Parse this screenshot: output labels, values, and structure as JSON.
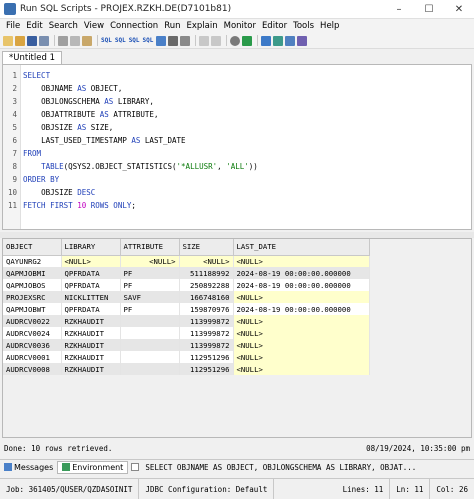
{
  "window": {
    "title": "Run SQL Scripts - PROJEX.RZKH.DE(D7101b81)",
    "minimize": "–",
    "maximize": "☐",
    "close": "✕"
  },
  "menu": [
    "File",
    "Edit",
    "Search",
    "View",
    "Connection",
    "Run",
    "Explain",
    "Monitor",
    "Editor",
    "Tools",
    "Help"
  ],
  "editor_tab": "*Untitled 1",
  "code": {
    "line_numbers": [
      "1",
      "2",
      "3",
      "4",
      "5",
      "6",
      "7",
      "8",
      "9",
      "10",
      "11"
    ]
  },
  "results": {
    "columns": [
      "OBJECT",
      "LIBRARY",
      "ATTRIBUTE",
      "SIZE",
      "LAST_DATE"
    ],
    "rows": [
      [
        "QAYUNRG2",
        "<NULL>",
        "<NULL>",
        "<NULL>",
        "<NULL>"
      ],
      [
        "QAPMJOBMI",
        "QPFRDATA",
        "PF",
        "511188992",
        "2024-08-19 00:00:00.000000"
      ],
      [
        "QAPMJOBOS",
        "QPFRDATA",
        "PF",
        "250892288",
        "2024-08-19 00:00:00.000000"
      ],
      [
        "PROJEXSRC",
        "NICKLITTEN",
        "SAVF",
        "166748160",
        "<NULL>"
      ],
      [
        "QAPMJOBWT",
        "QPFRDATA",
        "PF",
        "159870976",
        "2024-08-19 00:00:00.000000"
      ],
      [
        "AUDRCV0022",
        "RZKHAUDIT",
        "",
        "113999872",
        "<NULL>"
      ],
      [
        "AUDRCV0024",
        "RZKHAUDIT",
        "",
        "113999872",
        "<NULL>"
      ],
      [
        "AUDRCV0036",
        "RZKHAUDIT",
        "",
        "113999872",
        "<NULL>"
      ],
      [
        "AUDRCV0001",
        "RZKHAUDIT",
        "",
        "112951296",
        "<NULL>"
      ],
      [
        "AUDRCV0008",
        "RZKHAUDIT",
        "",
        "112951296",
        "<NULL>"
      ]
    ]
  },
  "status": {
    "left": "Done: 10 rows retrieved.",
    "right": "08/19/2024, 10:35:00 pm"
  },
  "bottom_tabs": {
    "messages": "Messages",
    "environment": "Environment",
    "preview": "SELECT OBJNAME AS OBJECT, OBJLONGSCHEMA AS LIBRARY, OBJAT..."
  },
  "footer": {
    "job": "Job: 361405/QUSER/QZDASOINIT",
    "jdbc": "JDBC Configuration: Default",
    "lines": "Lines: 11",
    "ln": "Ln: 11",
    "col": "Col: 26"
  },
  "colors": {
    "keyword": "#1f3fb8",
    "string": "#0a7a0a",
    "number": "#c000c0",
    "null_highlight": "#ffffcc"
  }
}
